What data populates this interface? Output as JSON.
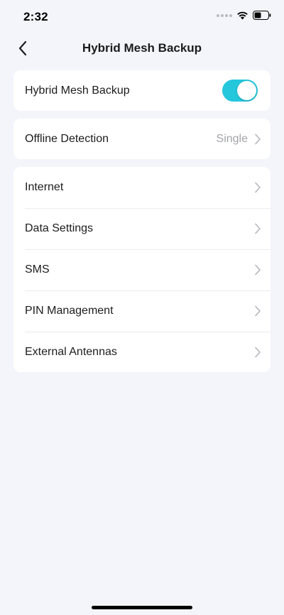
{
  "status_bar": {
    "time": "2:32",
    "wifi_icon": "wifi-icon",
    "battery_icon": "battery-icon"
  },
  "nav": {
    "title": "Hybrid Mesh Backup",
    "back_icon": "chevron-left-icon"
  },
  "hybrid_backup": {
    "label": "Hybrid Mesh Backup",
    "enabled": true,
    "toggle_color": "#24c7dc"
  },
  "offline_detection": {
    "label": "Offline Detection",
    "value": "Single"
  },
  "menu": {
    "items": [
      {
        "label": "Internet"
      },
      {
        "label": "Data Settings"
      },
      {
        "label": "SMS"
      },
      {
        "label": "PIN Management"
      },
      {
        "label": "External Antennas"
      }
    ]
  }
}
